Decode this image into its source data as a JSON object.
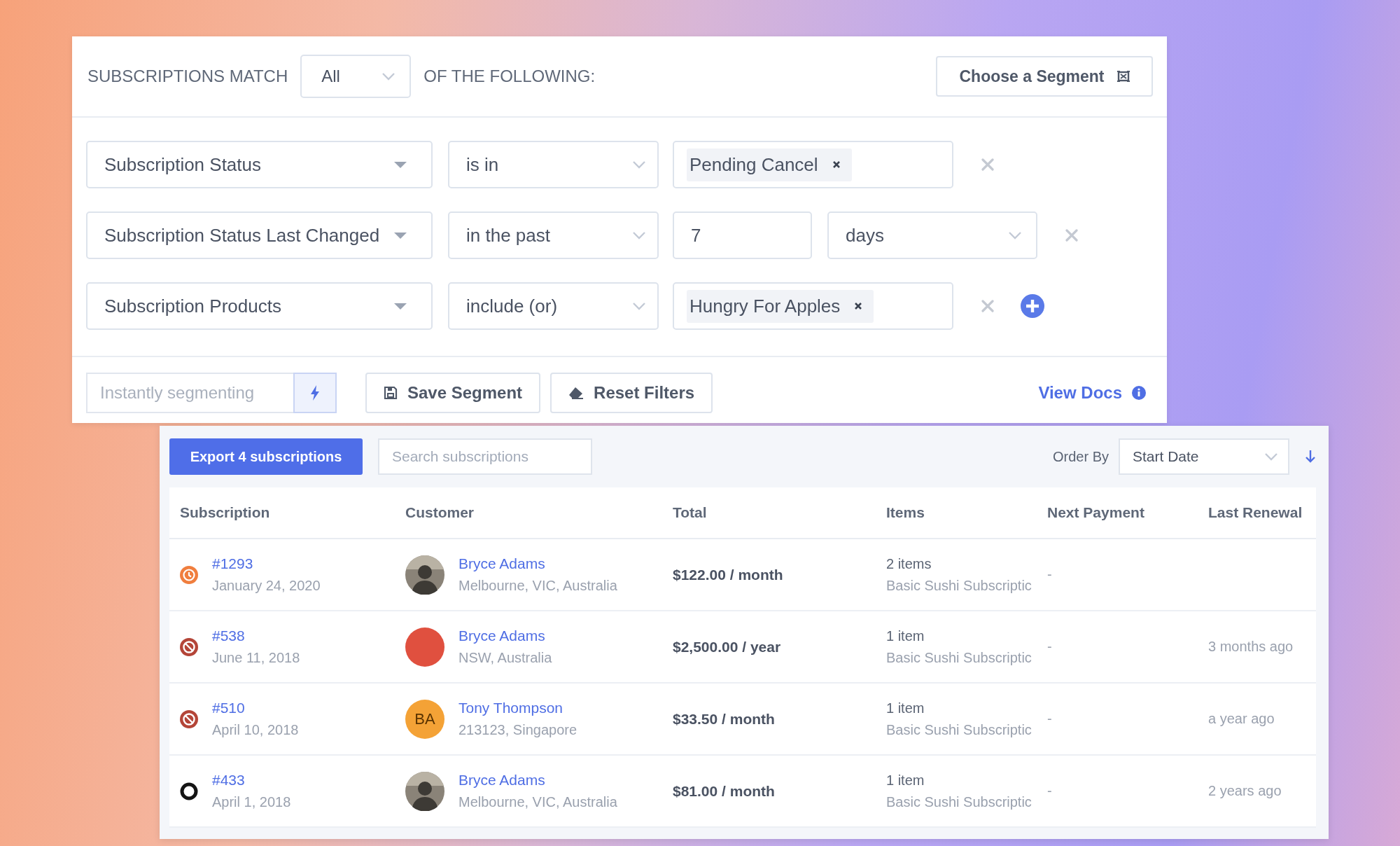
{
  "filter_panel": {
    "match_label": "SUBSCRIPTIONS MATCH",
    "match_value": "All",
    "match_suffix": "OF THE FOLLOWING:",
    "segment_button": "Choose a Segment",
    "filters": [
      {
        "field": "Subscription Status",
        "operator": "is in",
        "kind": "tags",
        "tags": [
          "Pending Cancel"
        ],
        "can_add": false
      },
      {
        "field": "Subscription Status Last Changed",
        "operator": "in the past",
        "kind": "period",
        "amount": "7",
        "unit": "days",
        "can_add": false
      },
      {
        "field": "Subscription Products",
        "operator": "include (or)",
        "kind": "tags",
        "tags": [
          "Hungry For Apples"
        ],
        "can_add": true
      }
    ],
    "segment_name": {
      "placeholder": "Instantly segmenting"
    },
    "save_button": "Save Segment",
    "reset_button": "Reset Filters",
    "docs_link": "View Docs"
  },
  "list_panel": {
    "export_button": "Export 4 subscriptions",
    "search": {
      "placeholder": "Search subscriptions"
    },
    "order_label": "Order By",
    "order_value": "Start Date",
    "table": {
      "columns": [
        "Subscription",
        "Customer",
        "Total",
        "Items",
        "Next Payment",
        "Last Renewal"
      ],
      "rows": [
        {
          "kind": "pending-cancel",
          "number": "#1293",
          "date": "January 24, 2020",
          "avatar": {
            "kind": "photo"
          },
          "customer": "Bryce Adams",
          "location": "Melbourne, VIC, Australia",
          "total": "$122.00 / month",
          "items": "2 items",
          "product": "Basic Sushi Subscriptic",
          "next_payment": "-"
        },
        {
          "kind": "cancelled",
          "number": "#538",
          "date": "June 11, 2018",
          "avatar": {
            "kind": "color",
            "color": "#e0503f"
          },
          "customer": "Bryce Adams",
          "location": "NSW, Australia",
          "total": "$2,500.00 / year",
          "items": "1 item",
          "product": "Basic Sushi Subscriptic",
          "next_payment": "-",
          "last_renewal": "3 months ago"
        },
        {
          "kind": "cancelled",
          "number": "#510",
          "date": "April 10, 2018",
          "avatar": {
            "kind": "initials",
            "color": "#f4a236",
            "text": "BA"
          },
          "customer": "Tony Thompson",
          "location": "213123, Singapore",
          "total": "$33.50 / month",
          "items": "1 item",
          "product": "Basic Sushi Subscriptic",
          "next_payment": "-",
          "last_renewal": "a year ago"
        },
        {
          "kind": "on-hold",
          "number": "#433",
          "date": "April 1, 2018",
          "avatar": {
            "kind": "photo"
          },
          "customer": "Bryce Adams",
          "location": "Melbourne, VIC, Australia",
          "total": "$81.00 / month",
          "items": "1 item",
          "product": "Basic Sushi Subscriptic",
          "next_payment": "-",
          "last_renewal": "2 years ago"
        }
      ]
    }
  }
}
